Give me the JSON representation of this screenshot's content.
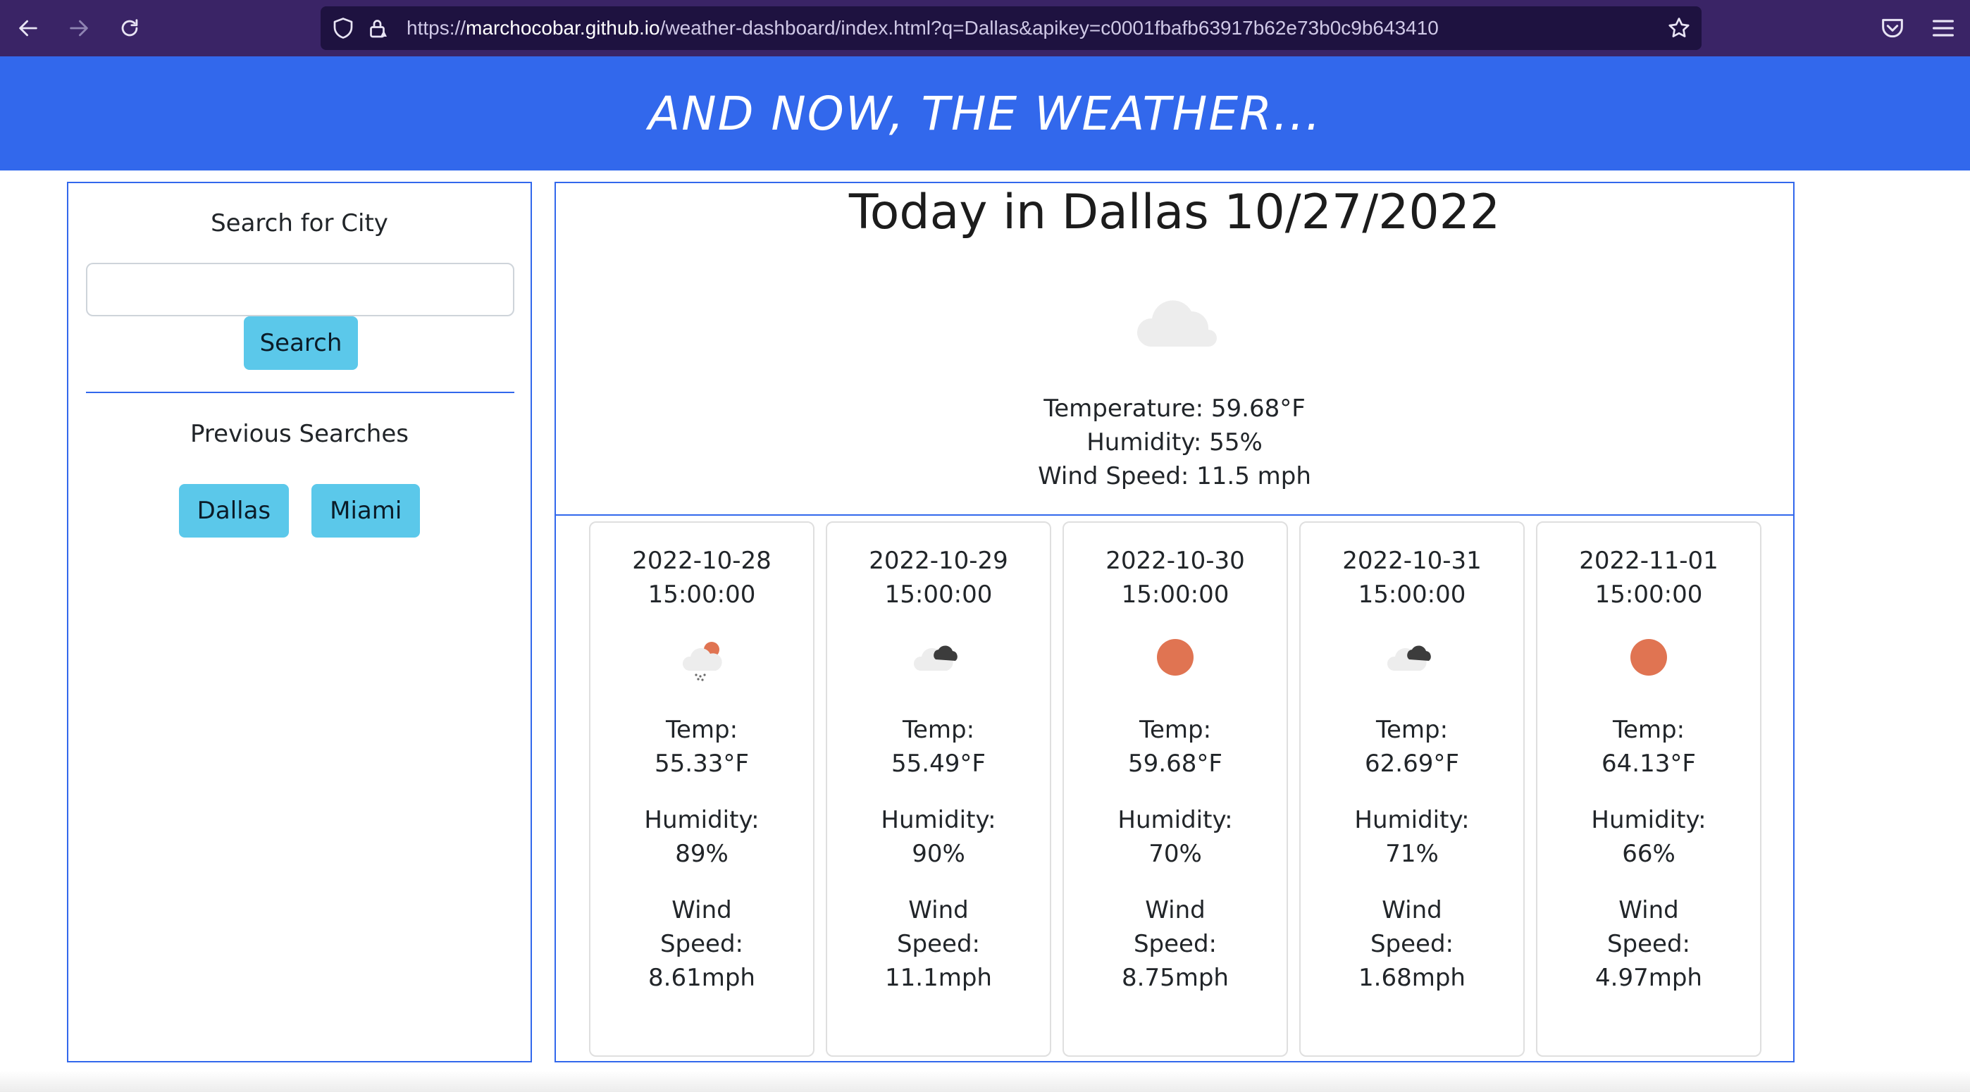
{
  "browser": {
    "url_scheme": "https://",
    "url_host": "marchocobar.github.io",
    "url_path": "/weather-dashboard/index.html?q=Dallas&apikey=c0001fbafb63917b62e73b0c9b643410",
    "icons": [
      "back-icon",
      "forward-icon",
      "reload-icon",
      "shield-icon",
      "lock-icon",
      "bookmark-star-icon",
      "pocket-icon",
      "menu-icon"
    ]
  },
  "header": {
    "title": "AND NOW, THE WEATHER..."
  },
  "sidebar": {
    "search_title": "Search for City",
    "search_placeholder": "",
    "search_button": "Search",
    "previous_title": "Previous Searches",
    "previous": [
      "Dallas",
      "Miami"
    ]
  },
  "today": {
    "title": "Today in Dallas 10/27/2022",
    "icon": "cloud-icon",
    "temperature": "Temperature: 59.68°F",
    "humidity": "Humidity: 55%",
    "wind": "Wind Speed: 11.5 mph"
  },
  "forecast": [
    {
      "date": "2022-10-28",
      "time": "15:00:00",
      "icon": "light-rain-sun-icon",
      "temp_label": "Temp:",
      "temp": "55.33°F",
      "humidity_label": "Humidity:",
      "humidity": "89%",
      "wind_label_1": "Wind",
      "wind_label_2": "Speed:",
      "wind": "8.61mph"
    },
    {
      "date": "2022-10-29",
      "time": "15:00:00",
      "icon": "broken-clouds-icon",
      "temp_label": "Temp:",
      "temp": "55.49°F",
      "humidity_label": "Humidity:",
      "humidity": "90%",
      "wind_label_1": "Wind",
      "wind_label_2": "Speed:",
      "wind": "11.1mph"
    },
    {
      "date": "2022-10-30",
      "time": "15:00:00",
      "icon": "sun-icon",
      "temp_label": "Temp:",
      "temp": "59.68°F",
      "humidity_label": "Humidity:",
      "humidity": "70%",
      "wind_label_1": "Wind",
      "wind_label_2": "Speed:",
      "wind": "8.75mph"
    },
    {
      "date": "2022-10-31",
      "time": "15:00:00",
      "icon": "broken-clouds-icon",
      "temp_label": "Temp:",
      "temp": "62.69°F",
      "humidity_label": "Humidity:",
      "humidity": "71%",
      "wind_label_1": "Wind",
      "wind_label_2": "Speed:",
      "wind": "1.68mph"
    },
    {
      "date": "2022-11-01",
      "time": "15:00:00",
      "icon": "sun-icon",
      "temp_label": "Temp:",
      "temp": "64.13°F",
      "humidity_label": "Humidity:",
      "humidity": "66%",
      "wind_label_1": "Wind",
      "wind_label_2": "Speed:",
      "wind": "4.97mph"
    }
  ],
  "colors": {
    "browser_bar": "#3a2466",
    "header_blue": "#3268ec",
    "button_info": "#5bc8ea",
    "sun": "#e07452",
    "cloud": "#ededed"
  }
}
